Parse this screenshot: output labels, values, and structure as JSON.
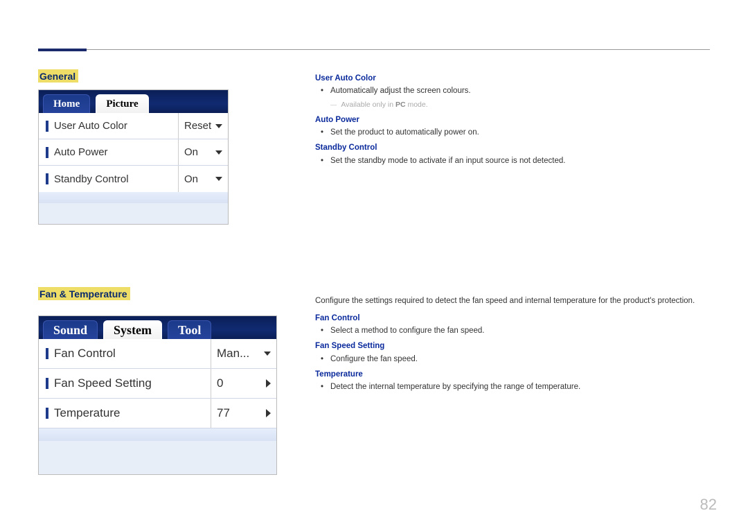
{
  "page_number": "82",
  "section1": {
    "title": "General",
    "tabs": {
      "home": "Home",
      "picture": "Picture"
    },
    "rows": {
      "user_auto_color": {
        "label": "User Auto Color",
        "value": "Reset"
      },
      "auto_power": {
        "label": "Auto Power",
        "value": "On"
      },
      "standby_control": {
        "label": "Standby Control",
        "value": "On"
      }
    },
    "desc": {
      "user_auto_color": {
        "head": "User Auto Color",
        "bullet": "Automatically adjust the screen colours.",
        "note_pre": "Available only in ",
        "note_bold": "PC",
        "note_post": " mode."
      },
      "auto_power": {
        "head": "Auto Power",
        "bullet": "Set the product to automatically power on."
      },
      "standby_control": {
        "head": "Standby Control",
        "bullet": "Set the standby mode to activate if an input source is not detected."
      }
    }
  },
  "section2": {
    "title": "Fan & Temperature",
    "tabs": {
      "sound": "Sound",
      "system": "System",
      "tool": "Tool"
    },
    "rows": {
      "fan_control": {
        "label": "Fan Control",
        "value": "Man..."
      },
      "fan_speed_setting": {
        "label": "Fan Speed Setting",
        "value": "0"
      },
      "temperature": {
        "label": "Temperature",
        "value": "77"
      }
    },
    "intro": "Configure the settings required to detect the fan speed and internal temperature for the product's protection.",
    "desc": {
      "fan_control": {
        "head": "Fan Control",
        "bullet": "Select a method to configure the fan speed."
      },
      "fan_speed_setting": {
        "head": "Fan Speed Setting",
        "bullet": "Configure the fan speed."
      },
      "temperature": {
        "head": "Temperature",
        "bullet": "Detect the internal temperature by specifying the range of temperature."
      }
    }
  }
}
